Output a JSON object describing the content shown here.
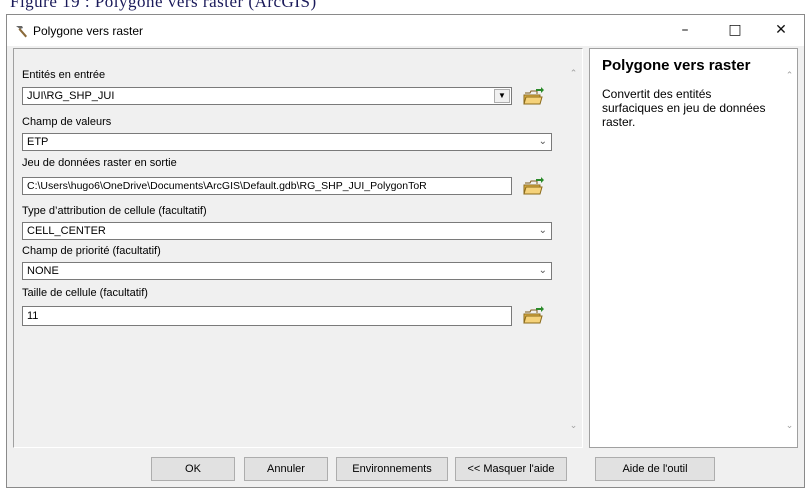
{
  "caption": "Figure 19 : Polygone vers raster (ArcGIS)",
  "window": {
    "title": "Polygone vers raster",
    "minimize": "–",
    "maximize": "□",
    "close": "✕"
  },
  "form": {
    "input_features_label": "Entités en entrée",
    "input_features_value": "JUI\\RG_SHP_JUI",
    "value_field_label": "Champ de valeurs",
    "value_field_value": "ETP",
    "output_raster_label": "Jeu de données raster en sortie",
    "output_raster_value": "C:\\Users\\hugo6\\OneDrive\\Documents\\ArcGIS\\Default.gdb\\RG_SHP_JUI_PolygonToR",
    "cell_assignment_label": "Type d’attribution de cellule (facultatif)",
    "cell_assignment_value": "CELL_CENTER",
    "priority_field_label": "Champ de priorité (facultatif)",
    "priority_field_value": "NONE",
    "cell_size_label": "Taille de cellule (facultatif)",
    "cell_size_value": "11"
  },
  "help": {
    "title": "Polygone vers raster",
    "text": "Convertit des entités surfaciques en jeu de données raster."
  },
  "buttons": {
    "ok": "OK",
    "cancel": "Annuler",
    "environments": "Environnements",
    "hide_help": "<< Masquer l'aide",
    "tool_help": "Aide de l'outil"
  },
  "icons": [
    "hammer-icon",
    "folder-open-icon",
    "chevron-down-icon",
    "scroll-up-icon",
    "scroll-down-icon"
  ],
  "colors": {
    "window_bg": "#f0f0f0",
    "folder": "#e8b84a"
  }
}
